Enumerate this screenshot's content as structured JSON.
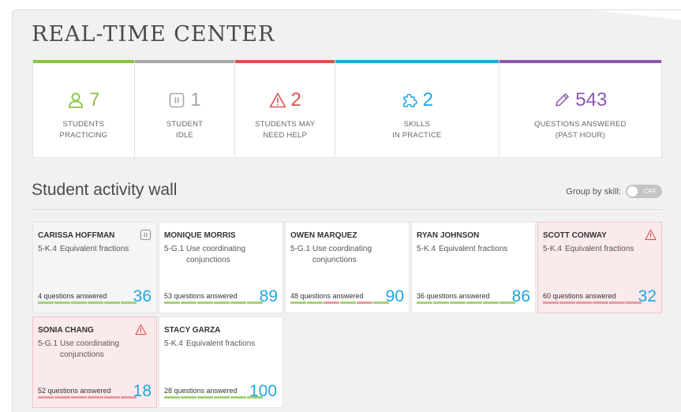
{
  "page": {
    "title": "REAL-TIME CENTER"
  },
  "stats": [
    {
      "value": "7",
      "label_line1": "STUDENTS",
      "label_line2": "PRACTICING",
      "color": "#8ac53f",
      "icon": "student-icon"
    },
    {
      "value": "1",
      "label_line1": "STUDENT",
      "label_line2": "IDLE",
      "color": "#a7a7a7",
      "icon": "pause-icon"
    },
    {
      "value": "2",
      "label_line1": "STUDENTS MAY",
      "label_line2": "NEED HELP",
      "color": "#d9534f",
      "icon": "warning-icon"
    },
    {
      "value": "2",
      "label_line1": "SKILLS",
      "label_line2": "IN PRACTICE",
      "color": "#1ea7e1",
      "icon": "puzzle-icon"
    },
    {
      "value": "543",
      "label_line1": "QUESTIONS ANSWERED",
      "label_line2": "(PAST HOUR)",
      "color": "#8b58ad",
      "icon": "pencil-icon"
    }
  ],
  "wall": {
    "title": "Student activity wall",
    "group_label": "Group by skill:",
    "toggle_label": "OFF"
  },
  "students": [
    {
      "name": "CARISSA HOFFMAN",
      "status": "idle",
      "skill_code": "5-K.4",
      "skill_name": "Equivalent fractions",
      "answered": "4 questions answered",
      "score": "36"
    },
    {
      "name": "MONIQUE MORRIS",
      "status": "practicing",
      "skill_code": "5-G.1",
      "skill_name": "Use coordinating conjunctions",
      "answered": "53 questions answered",
      "score": "89"
    },
    {
      "name": "OWEN MARQUEZ",
      "status": "practicing",
      "skill_code": "5-G.1",
      "skill_name": "Use coordinating conjunctions",
      "answered": "48 questions answered",
      "score": "90"
    },
    {
      "name": "RYAN JOHNSON",
      "status": "practicing",
      "skill_code": "5-K.4",
      "skill_name": "Equivalent fractions",
      "answered": "36 questions answered",
      "score": "86"
    },
    {
      "name": "SCOTT CONWAY",
      "status": "help",
      "skill_code": "5-K.4",
      "skill_name": "Equivalent fractions",
      "answered": "60 questions answered",
      "score": "32"
    },
    {
      "name": "SONIA CHANG",
      "status": "help",
      "skill_code": "5-G.1",
      "skill_name": "Use coordinating conjunctions",
      "answered": "52 questions answered",
      "score": "18"
    },
    {
      "name": "STACY GARZA",
      "status": "practicing",
      "skill_code": "5-K.4",
      "skill_name": "Equivalent fractions",
      "answered": "28 questions answered",
      "score": "100"
    }
  ],
  "progress_colors": {
    "good": "#a6d07a",
    "bad": "#e89aa3"
  },
  "progress_segments": [
    [
      "good",
      "good",
      "good",
      "good",
      "good",
      "good"
    ],
    [
      "good",
      "good",
      "good",
      "good",
      "good",
      "good"
    ],
    [
      "good",
      "good",
      "bad",
      "good",
      "bad",
      "good"
    ],
    [
      "good",
      "good",
      "good",
      "good",
      "good",
      "good"
    ],
    [
      "bad",
      "bad",
      "bad",
      "bad",
      "bad",
      "bad"
    ],
    [
      "bad",
      "bad",
      "bad",
      "bad",
      "bad",
      "bad"
    ],
    [
      "good",
      "good",
      "good",
      "good",
      "good",
      "good"
    ]
  ]
}
